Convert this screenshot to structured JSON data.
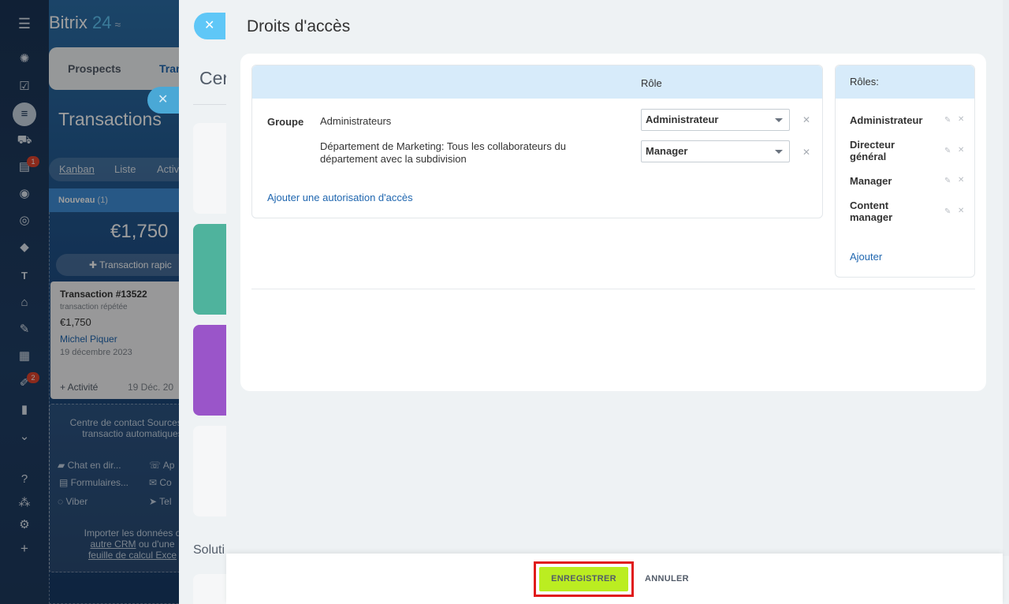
{
  "nav": {
    "icons": [
      "menu-icon",
      "activity-stream-icon",
      "tasks-icon",
      "crm-icon",
      "shop-icon",
      "contacts-icon",
      "robot-icon",
      "target-icon",
      "box-icon",
      "text-icon",
      "bank-icon",
      "sign-icon",
      "calendar-icon",
      "forms-icon",
      "analytics-icon",
      "more-icon",
      "help-icon",
      "sitemap-icon",
      "settings-icon",
      "add-icon"
    ],
    "badge_contacts": "1",
    "badge_forms": "2"
  },
  "crm": {
    "logo_name": "Bitrix",
    "logo_num": " 24",
    "tabs": [
      "Prospects",
      "Tran"
    ],
    "page_title": "Transactions",
    "views": [
      "Kanban",
      "Liste",
      "Activ"
    ],
    "column": {
      "name": "Nouveau",
      "count": "(1)",
      "sum": "€1,750",
      "quick_add": "Transaction rapic"
    },
    "card": {
      "title": "Transaction #13522",
      "subtitle": "transaction répétée",
      "amount": "€1,750",
      "person": "Michel Piquer",
      "date": "19 décembre 2023",
      "activity": "+ Activité",
      "activity_date": "19 Déc. 20"
    },
    "contact_center": {
      "title": "Centre de contact Sources de transactio automatiques",
      "items": [
        "Chat en dir...",
        "Ap",
        "Formulaires...",
        "Co",
        "Viber",
        "Tel"
      ],
      "import_text": "Importer les données d",
      "import_link1": "autre CRM",
      "import_mid": " ou d'une",
      "import_link2": "feuille de calcul Exce"
    }
  },
  "panel2": {
    "title": "Cer",
    "solutions": "Soluti"
  },
  "panel": {
    "title": "Droits d'accès",
    "table": {
      "role_header": "Rôle",
      "group_label": "Groupe",
      "rows": [
        {
          "name": "Administrateurs",
          "role": "Administrateur"
        },
        {
          "name": "Département de Marketing: Tous les collaborateurs du département avec la subdivision",
          "role": "Manager"
        }
      ],
      "add_link": "Ajouter une autorisation d'accès"
    },
    "roles": {
      "header": "Rôles:",
      "items": [
        "Administrateur",
        "Directeur général",
        "Manager",
        "Content manager"
      ],
      "add_link": "Ajouter"
    }
  },
  "footer": {
    "save_label": "ENREGISTRER",
    "cancel_label": "ANNULER"
  },
  "colors": {
    "accent": "#2067b0",
    "save": "#bbed21",
    "highlight": "#e01b1b",
    "header": "#d7ebfa"
  }
}
